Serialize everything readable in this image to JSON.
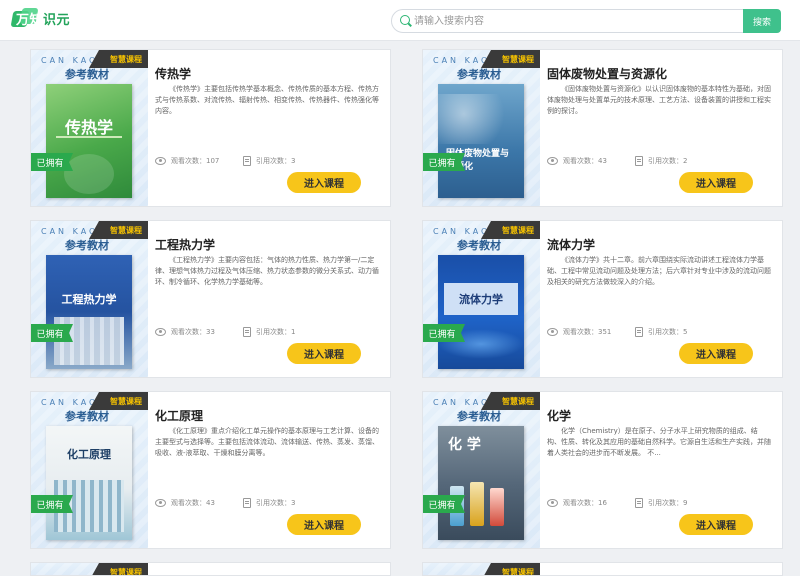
{
  "header": {
    "logo_text_main": "万知",
    "logo_text_tail": "识元",
    "search_placeholder": "请输入搜索内容",
    "search_button": "搜索"
  },
  "labels": {
    "cankao": "CAN KAO",
    "cankao_title": "参考教材",
    "ribbon": "智慧课程",
    "owned": "已拥有",
    "views_prefix": "观看次数：",
    "cites_prefix": "引用次数：",
    "enter": "进入课程"
  },
  "courses": [
    {
      "title": "传热学",
      "cover_title": "传热学",
      "cover_bg": "#5db55a",
      "desc": "《传热学》主要包括传热学基本概念、传热传质的基本方程、传热方式与传热系数、对流传热、辐射传热、相变传热、传热器件、传热强化等内容。",
      "views": "107",
      "cites": "3"
    },
    {
      "title": "固体废物处置与资源化",
      "cover_title": "固体废物处置与资源化",
      "cover_bg": "#3f7fae",
      "desc": "《固体废物处置与资源化》以认识固体废物的基本特性为基础，对固体废物处理与处置单元的技术原理、工艺方法、设备装置的讲授和工程实例的探讨。",
      "views": "43",
      "cites": "2"
    },
    {
      "title": "工程热力学",
      "cover_title": "工程热力学",
      "cover_bg": "#2c5fb0",
      "desc": "《工程热力学》主要内容包括：气体的热力性质、热力学第一/二定律、理想气体热力过程及气体压缩、热力状态参数的微分关系式、动力循环、制冷循环、化学热力学基础等。",
      "views": "33",
      "cites": "1"
    },
    {
      "title": "流体力学",
      "cover_title": "流体力学",
      "cover_bg": "#1b58b8",
      "desc": "《流体力学》共十二章。前六章围绕实际流动讲述工程流体力学基础、工程中常见流动问题及处理方法；后六章针对专业中涉及的流动问题及相关的研究方法做较深入的介绍。",
      "views": "351",
      "cites": "5"
    },
    {
      "title": "化工原理",
      "cover_title": "化工原理",
      "cover_bg": "#eef2f4",
      "desc": "《化工原理》重点介绍化工单元操作的基本原理与工艺计算、设备的主要型式与选择等。主要包括流体流动、流体输送、传热、蒸发、蒸馏、吸收、液-液萃取、干燥和膜分离等。",
      "views": "43",
      "cites": "3"
    },
    {
      "title": "化学",
      "cover_title": "化 学",
      "cover_bg": "#5b6f80",
      "desc": "化学（Chemistry）是在原子、分子水平上研究物质的组成、结构、性质、转化及其应用的基础自然科学。它源自生活和生产实践，并随着人类社会的进步而不断发展。 不...",
      "views": "16",
      "cites": "9"
    }
  ],
  "partial_cards": [
    {
      "ribbon": "智慧课程"
    },
    {
      "ribbon": "智慧课程"
    }
  ]
}
